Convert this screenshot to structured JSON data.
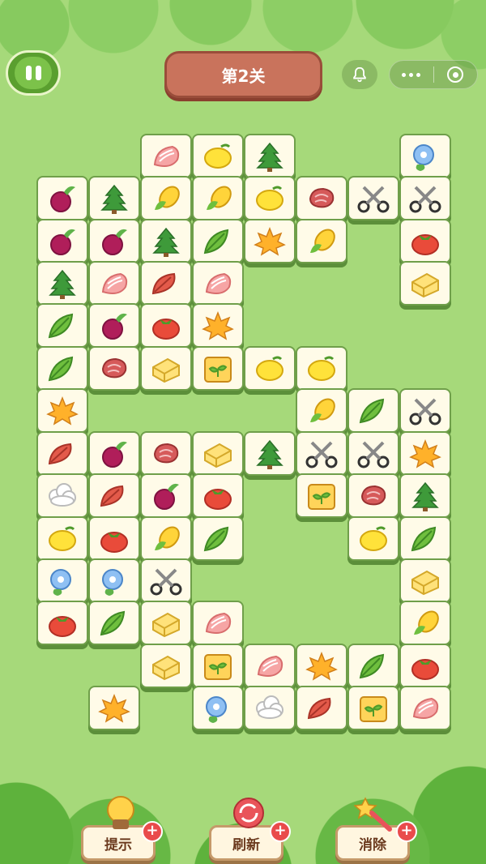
{
  "level": {
    "title": "第2关"
  },
  "toolbar": {
    "hint_label": "提示",
    "refresh_label": "刷新",
    "remove_label": "消除",
    "plus_symbol": "+"
  },
  "colors": {
    "background": "#a6d97a",
    "tile_face": "#fffbe8",
    "tile_edge": "#5c8f3a",
    "banner": "#c9735c"
  },
  "tiles": [
    {
      "icon": "salmon",
      "col": 2,
      "row": 0
    },
    {
      "icon": "lemon",
      "col": 3,
      "row": 0
    },
    {
      "icon": "pine",
      "col": 4,
      "row": 0
    },
    {
      "icon": "flower",
      "col": 7,
      "row": 0
    },
    {
      "icon": "beet",
      "col": 0,
      "row": 1
    },
    {
      "icon": "pine",
      "col": 1,
      "row": 1
    },
    {
      "icon": "corn",
      "col": 2,
      "row": 1
    },
    {
      "icon": "corn",
      "col": 3,
      "row": 1
    },
    {
      "icon": "lemon",
      "col": 4,
      "row": 1
    },
    {
      "icon": "steak",
      "col": 5,
      "row": 1
    },
    {
      "icon": "scissors",
      "col": 6,
      "row": 1
    },
    {
      "icon": "scissors",
      "col": 7,
      "row": 1
    },
    {
      "icon": "beet",
      "col": 0,
      "row": 2
    },
    {
      "icon": "beet",
      "col": 1,
      "row": 2
    },
    {
      "icon": "pine",
      "col": 2,
      "row": 2
    },
    {
      "icon": "leaf",
      "col": 3,
      "row": 2
    },
    {
      "icon": "maple",
      "col": 4,
      "row": 2
    },
    {
      "icon": "corn",
      "col": 5,
      "row": 2
    },
    {
      "icon": "tomato",
      "col": 7,
      "row": 2
    },
    {
      "icon": "pine",
      "col": 0,
      "row": 3
    },
    {
      "icon": "salmon",
      "col": 1,
      "row": 3
    },
    {
      "icon": "redleaf",
      "col": 2,
      "row": 3
    },
    {
      "icon": "salmon",
      "col": 3,
      "row": 3
    },
    {
      "icon": "butter",
      "col": 7,
      "row": 3
    },
    {
      "icon": "leaf",
      "col": 0,
      "row": 4
    },
    {
      "icon": "beet",
      "col": 1,
      "row": 4
    },
    {
      "icon": "tomato",
      "col": 2,
      "row": 4
    },
    {
      "icon": "maple",
      "col": 3,
      "row": 4
    },
    {
      "icon": "leaf",
      "col": 0,
      "row": 5
    },
    {
      "icon": "steak",
      "col": 1,
      "row": 5
    },
    {
      "icon": "butter",
      "col": 2,
      "row": 5
    },
    {
      "icon": "seed",
      "col": 3,
      "row": 5
    },
    {
      "icon": "lemon",
      "col": 4,
      "row": 5
    },
    {
      "icon": "lemon",
      "col": 5,
      "row": 5
    },
    {
      "icon": "maple",
      "col": 0,
      "row": 6
    },
    {
      "icon": "corn",
      "col": 5,
      "row": 6
    },
    {
      "icon": "leaf",
      "col": 6,
      "row": 6
    },
    {
      "icon": "scissors",
      "col": 7,
      "row": 6
    },
    {
      "icon": "redleaf",
      "col": 0,
      "row": 7
    },
    {
      "icon": "beet",
      "col": 1,
      "row": 7
    },
    {
      "icon": "steak",
      "col": 2,
      "row": 7
    },
    {
      "icon": "butter",
      "col": 3,
      "row": 7
    },
    {
      "icon": "pine",
      "col": 4,
      "row": 7
    },
    {
      "icon": "scissors",
      "col": 5,
      "row": 7
    },
    {
      "icon": "scissors",
      "col": 6,
      "row": 7
    },
    {
      "icon": "maple",
      "col": 7,
      "row": 7
    },
    {
      "icon": "cauliflower",
      "col": 0,
      "row": 8
    },
    {
      "icon": "redleaf",
      "col": 1,
      "row": 8
    },
    {
      "icon": "beet",
      "col": 2,
      "row": 8
    },
    {
      "icon": "tomato",
      "col": 3,
      "row": 8
    },
    {
      "icon": "seed",
      "col": 5,
      "row": 8
    },
    {
      "icon": "steak",
      "col": 6,
      "row": 8
    },
    {
      "icon": "pine",
      "col": 7,
      "row": 8
    },
    {
      "icon": "lemon",
      "col": 0,
      "row": 9
    },
    {
      "icon": "tomato",
      "col": 1,
      "row": 9
    },
    {
      "icon": "corn",
      "col": 2,
      "row": 9
    },
    {
      "icon": "leaf",
      "col": 3,
      "row": 9
    },
    {
      "icon": "lemon",
      "col": 6,
      "row": 9
    },
    {
      "icon": "leaf",
      "col": 7,
      "row": 9
    },
    {
      "icon": "flower",
      "col": 0,
      "row": 10
    },
    {
      "icon": "flower",
      "col": 1,
      "row": 10
    },
    {
      "icon": "scissors",
      "col": 2,
      "row": 10
    },
    {
      "icon": "butter",
      "col": 7,
      "row": 10
    },
    {
      "icon": "tomato",
      "col": 0,
      "row": 11
    },
    {
      "icon": "leaf",
      "col": 1,
      "row": 11
    },
    {
      "icon": "butter",
      "col": 2,
      "row": 11
    },
    {
      "icon": "salmon",
      "col": 3,
      "row": 11
    },
    {
      "icon": "corn",
      "col": 7,
      "row": 11
    },
    {
      "icon": "butter",
      "col": 2,
      "row": 12
    },
    {
      "icon": "seed",
      "col": 3,
      "row": 12
    },
    {
      "icon": "salmon",
      "col": 4,
      "row": 12
    },
    {
      "icon": "maple",
      "col": 5,
      "row": 12
    },
    {
      "icon": "leaf",
      "col": 6,
      "row": 12
    },
    {
      "icon": "tomato",
      "col": 7,
      "row": 12
    },
    {
      "icon": "maple",
      "col": 1,
      "row": 13
    },
    {
      "icon": "flower",
      "col": 3,
      "row": 13
    },
    {
      "icon": "cauliflower",
      "col": 4,
      "row": 13
    },
    {
      "icon": "redleaf",
      "col": 5,
      "row": 13
    },
    {
      "icon": "seed",
      "col": 6,
      "row": 13
    },
    {
      "icon": "salmon",
      "col": 7,
      "row": 13
    }
  ]
}
